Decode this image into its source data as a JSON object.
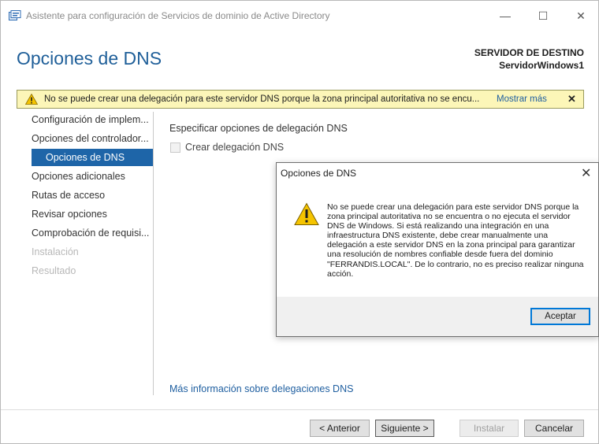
{
  "window": {
    "title": "Asistente para configuración de Servicios de dominio de Active Directory",
    "minimize_glyph": "—",
    "maximize_glyph": "☐",
    "close_glyph": "✕"
  },
  "header": {
    "page_title": "Opciones de DNS",
    "target_label": "SERVIDOR DE DESTINO",
    "target_server": "ServidorWindows1"
  },
  "warning_bar": {
    "text": "No se puede crear una delegación para este servidor DNS porque la zona principal autoritativa no se encu...",
    "link": "Mostrar más",
    "close_glyph": "✕",
    "background": "#fcf6b8"
  },
  "nav": {
    "items": [
      {
        "label": "Configuración de implem...",
        "state": "normal"
      },
      {
        "label": "Opciones del controlador...",
        "state": "normal"
      },
      {
        "label": "Opciones de DNS",
        "state": "active"
      },
      {
        "label": "Opciones adicionales",
        "state": "normal"
      },
      {
        "label": "Rutas de acceso",
        "state": "normal"
      },
      {
        "label": "Revisar opciones",
        "state": "normal"
      },
      {
        "label": "Comprobación de requisi...",
        "state": "normal"
      },
      {
        "label": "Instalación",
        "state": "disabled"
      },
      {
        "label": "Resultado",
        "state": "disabled"
      }
    ],
    "active_color": "#1e65a8"
  },
  "main": {
    "section_label": "Especificar opciones de delegación DNS",
    "checkbox_label": "Crear delegación DNS",
    "checkbox_checked": false,
    "more_info_link": "Más información sobre delegaciones DNS"
  },
  "footer": {
    "prev_label": "< Anterior",
    "next_label": "Siguiente >",
    "install_label": "Instalar",
    "cancel_label": "Cancelar"
  },
  "dialog": {
    "title": "Opciones de DNS",
    "close_glyph": "✕",
    "message": "No se puede crear una delegación para este servidor DNS porque la zona principal autoritativa no se encuentra o no ejecuta el servidor DNS de Windows. Si está realizando una integración en una infraestructura DNS existente, debe crear manualmente una delegación a este servidor DNS en la zona principal para garantizar una resolución de nombres confiable desde fuera del dominio \"FERRANDIS.LOCAL\". De lo contrario, no es preciso realizar ninguna acción.",
    "ok_label": "Aceptar",
    "icon": "warning-icon"
  },
  "colors": {
    "title_blue": "#1f5f99",
    "link_blue": "#1f5fa0",
    "warning_yellow": "#f5c400"
  }
}
